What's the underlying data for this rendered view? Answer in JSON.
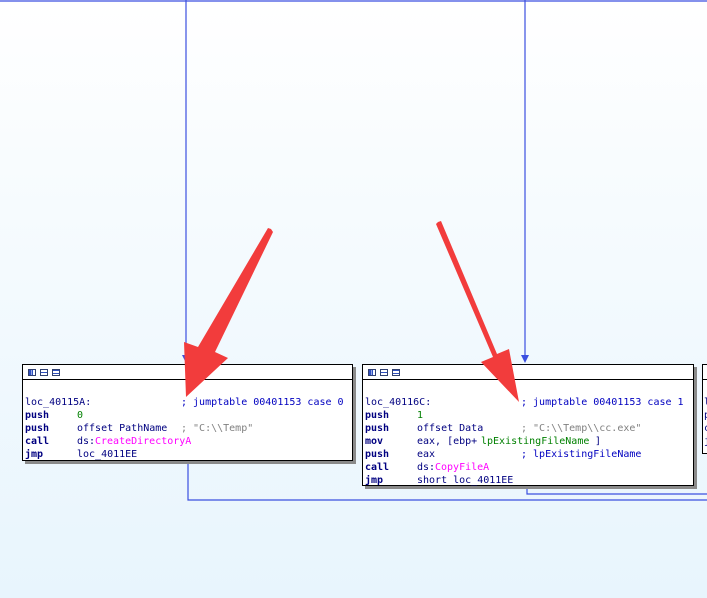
{
  "colors": {
    "edge": "#3b4fe0",
    "arrow_red": "#f23c3c",
    "import": "#ff00ff",
    "number": "#008000",
    "comment": "#808080"
  },
  "nodes": [
    {
      "id": "loc_40115A",
      "title_icons": [
        "graph-icon",
        "edit-icon",
        "list-icon"
      ],
      "lines": [
        {
          "label": "loc_40115A:",
          "comment": "; jumptable 00401153 case 0"
        },
        {
          "mnemonic": "push",
          "operand": "0"
        },
        {
          "mnemonic": "push",
          "operand": "offset PathName",
          "comment": "; \"C:\\\\Temp\""
        },
        {
          "mnemonic": "call",
          "operand_prefix": "ds:",
          "operand_import": "CreateDirectoryA"
        },
        {
          "mnemonic": "jmp",
          "operand": "loc_4011EE"
        }
      ]
    },
    {
      "id": "loc_40116C",
      "title_icons": [
        "graph-icon",
        "edit-icon",
        "list-icon"
      ],
      "lines": [
        {
          "label": "loc_40116C:",
          "comment": "; jumptable 00401153 case 1"
        },
        {
          "mnemonic": "push",
          "operand": "1"
        },
        {
          "mnemonic": "push",
          "operand": "offset Data",
          "comment": "; \"C:\\\\Temp\\\\cc.exe\""
        },
        {
          "mnemonic": "mov",
          "operand_prefix": "eax, [ebp+",
          "operand_var": "lpExistingFileName",
          "operand_suffix": "]"
        },
        {
          "mnemonic": "push",
          "operand": "eax",
          "comment": "; lpExistingFileName"
        },
        {
          "mnemonic": "call",
          "operand_prefix": "ds:",
          "operand_import": "CopyFileA"
        },
        {
          "mnemonic": "jmp",
          "operand": "short loc_4011EE"
        }
      ]
    },
    {
      "id": "partial_node_right",
      "lines": [
        {
          "label": "l"
        },
        {
          "label": "p"
        },
        {
          "label": "c"
        },
        {
          "label": "j"
        }
      ]
    }
  ]
}
